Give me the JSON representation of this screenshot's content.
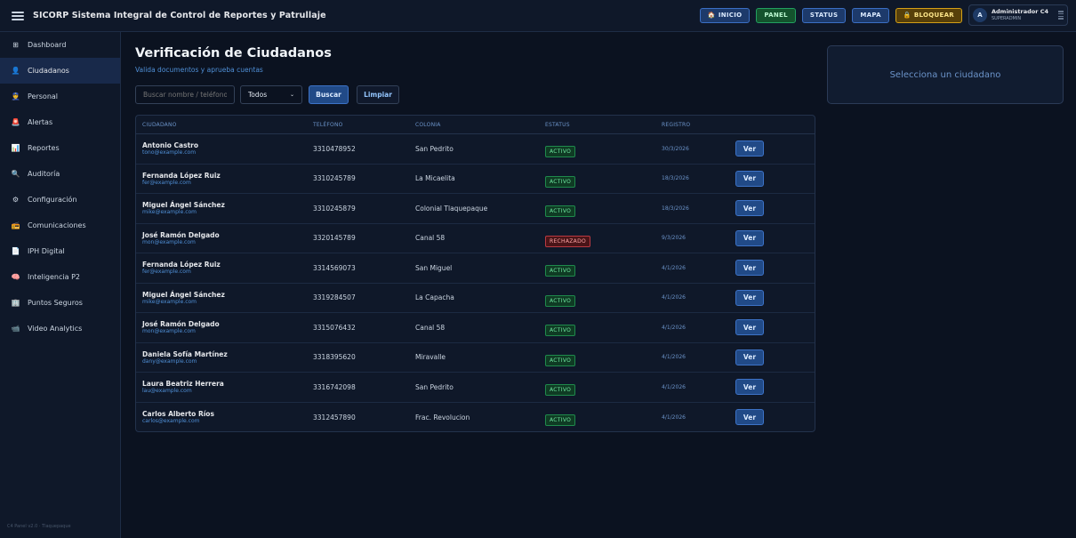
{
  "app": {
    "title": "SICORP Sistema Integral de Control de Reportes y Patrullaje"
  },
  "topbar": {
    "buttons": [
      {
        "label": "INICIO",
        "icon": "home-icon"
      },
      {
        "label": "PANEL"
      },
      {
        "label": "STATUS"
      },
      {
        "label": "MAPA"
      },
      {
        "label": "BLOQUEAR",
        "icon": "lock-icon"
      }
    ],
    "user": {
      "initial": "A",
      "name": "Administrador C4",
      "role": "SUPERADMIN"
    }
  },
  "sidebar": {
    "items": [
      {
        "label": "Dashboard",
        "icon": "grid-icon"
      },
      {
        "label": "Ciudadanos",
        "icon": "user-icon",
        "active": true
      },
      {
        "label": "Personal",
        "icon": "police-icon"
      },
      {
        "label": "Alertas",
        "icon": "siren-icon"
      },
      {
        "label": "Reportes",
        "icon": "bar-chart-icon"
      },
      {
        "label": "Auditoría",
        "icon": "magnifier-icon"
      },
      {
        "label": "Configuración",
        "icon": "gear-icon"
      },
      {
        "label": "Comunicaciones",
        "icon": "radio-icon"
      },
      {
        "label": "IPH Digital",
        "icon": "document-icon"
      },
      {
        "label": "Inteligencia P2",
        "icon": "brain-icon"
      },
      {
        "label": "Puntos Seguros",
        "icon": "building-icon"
      },
      {
        "label": "Video Analytics",
        "icon": "camera-icon"
      }
    ],
    "footer": "C4 Panel v2.0 · Tlaquepaque"
  },
  "main": {
    "title": "Verificación de Ciudadanos",
    "subtitle": "Valida documentos y aprueba cuentas",
    "search": {
      "placeholder": "Buscar nombre / teléfono / email",
      "value": ""
    },
    "filter": {
      "selected": "Todos"
    },
    "buscar_label": "Buscar",
    "limpiar_label": "Limpiar",
    "table": {
      "headers": [
        "CIUDADANO",
        "TELÉFONO",
        "COLONIA",
        "ESTATUS",
        "REGISTRO",
        ""
      ],
      "view_label": "Ver",
      "rows": [
        {
          "name": "Antonio Castro",
          "email": "tono@example.com",
          "phone": "3310478952",
          "colonia": "San Pedrito",
          "status": "ACTIVO",
          "date": "30/3/2026"
        },
        {
          "name": "Fernanda López Ruiz",
          "email": "fer@example.com",
          "phone": "3310245789",
          "colonia": "La Micaelita",
          "status": "ACTIVO",
          "date": "18/3/2026"
        },
        {
          "name": "Miguel Ángel Sánchez",
          "email": "mike@example.com",
          "phone": "3310245879",
          "colonia": "Colonial Tlaquepaque",
          "status": "ACTIVO",
          "date": "18/3/2026"
        },
        {
          "name": "José Ramón Delgado",
          "email": "mon@example.com",
          "phone": "3320145789",
          "colonia": "Canal 58",
          "status": "RECHAZADO",
          "date": "9/3/2026"
        },
        {
          "name": "Fernanda López Ruiz",
          "email": "fer@example.com",
          "phone": "3314569073",
          "colonia": "San Miguel",
          "status": "ACTIVO",
          "date": "4/1/2026"
        },
        {
          "name": "Miguel Ángel Sánchez",
          "email": "mike@example.com",
          "phone": "3319284507",
          "colonia": "La Capacha",
          "status": "ACTIVO",
          "date": "4/1/2026"
        },
        {
          "name": "José Ramón Delgado",
          "email": "mon@example.com",
          "phone": "3315076432",
          "colonia": "Canal 58",
          "status": "ACTIVO",
          "date": "4/1/2026"
        },
        {
          "name": "Daniela Sofía Martínez",
          "email": "dany@example.com",
          "phone": "3318395620",
          "colonia": "Miravalle",
          "status": "ACTIVO",
          "date": "4/1/2026"
        },
        {
          "name": "Laura Beatriz Herrera",
          "email": "lau@example.com",
          "phone": "3316742098",
          "colonia": "San Pedrito",
          "status": "ACTIVO",
          "date": "4/1/2026"
        },
        {
          "name": "Carlos Alberto Ríos",
          "email": "carlos@example.com",
          "phone": "3312457890",
          "colonia": "Frac. Revolucion",
          "status": "ACTIVO",
          "date": "4/1/2026"
        }
      ]
    }
  },
  "detail_panel": {
    "placeholder": "Selecciona un ciudadano"
  },
  "colors": {
    "background": "#0b1220",
    "panel": "#0f1829",
    "accent": "#214a87",
    "active_green": "#6ee7a0",
    "rejected_red": "#fca5a5"
  }
}
